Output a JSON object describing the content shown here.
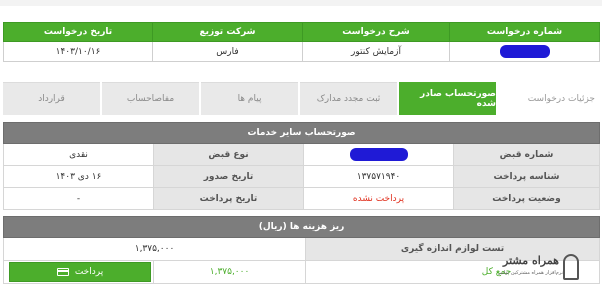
{
  "request_table": {
    "headers": [
      "شماره درخواست",
      "شرح درخواست",
      "شرکت توزیع",
      "تاریخ درخواست"
    ],
    "row": {
      "request_number": "",
      "description": "آزمایش کنتور",
      "company": "فارس",
      "date": "۱۴۰۳/۱۰/۱۶"
    }
  },
  "tabs": [
    {
      "label": "جزئیات درخواست",
      "state": "plain"
    },
    {
      "label": "صورتحساب صادر شده",
      "state": "active"
    },
    {
      "label": "ثبت مجدد مدارک",
      "state": "normal"
    },
    {
      "label": "پیام ها",
      "state": "normal"
    },
    {
      "label": "مفاصاحساب",
      "state": "normal"
    },
    {
      "label": "قرارداد",
      "state": "normal"
    }
  ],
  "invoice": {
    "title": "صورتحساب سایر خدمات",
    "rows": [
      {
        "label1": "شماره قبض",
        "value1": "",
        "label2": "نوع قبض",
        "value2": "نقدی"
      },
      {
        "label1": "شناسه پرداخت",
        "value1": "۱۳۷۵۷۱۹۴۰",
        "label2": "تاریخ صدور",
        "value2": "۱۶ دی ۱۴۰۳"
      },
      {
        "label1": "وضعیت پرداخت",
        "value1": "پرداخت نشده",
        "label2": "تاریخ پرداخت",
        "value2": "-"
      }
    ]
  },
  "costs": {
    "title": "ریز هزینه ها (ریال)",
    "item_label": "تست لوازم اندازه گیری",
    "item_amount": "۱,۳۷۵,۰۰۰",
    "total_label": "جمع کل",
    "total_amount": "۱,۳۷۵,۰۰۰",
    "pay_button": "پرداخت"
  },
  "logo": {
    "text": "همراه مشتر",
    "subtitle": "نرم‌افزار همراه مشترکین توانیر"
  },
  "colors": {
    "green": "#4cae2c",
    "gray_header": "#7d7d7d",
    "red": "#e0301e",
    "redaction": "#1f1ad6"
  }
}
